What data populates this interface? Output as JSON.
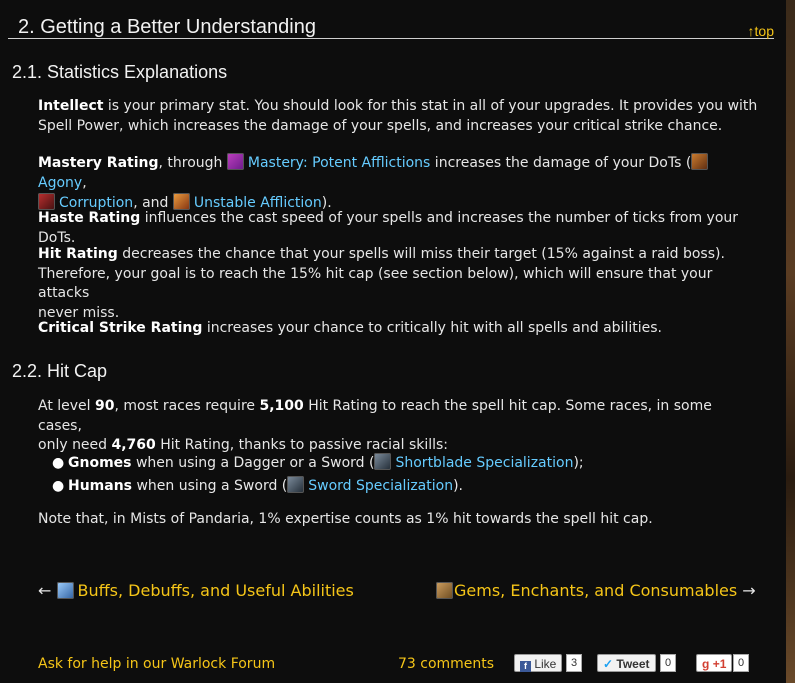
{
  "section": {
    "title": "2. Getting a Better Understanding",
    "top_link": "↑top"
  },
  "s21": {
    "title": "2.1. Statistics Explanations",
    "p1_bold": "Intellect",
    "p1_l1": " is your primary stat. You should look for this stat in all of your upgrades. It provides you with",
    "p1_l2": "Spell Power, which increases the damage of your spells, and increases your critical strike chance.",
    "p2_bold": "Mastery Rating",
    "p2_a": ", through ",
    "p2_link1": "Mastery: Potent Afflictions",
    "p2_b": " increases the damage of your DoTs (",
    "p2_link2": "Agony",
    "p2_c": ",",
    "p2_link3": "Corruption",
    "p2_d": ", and ",
    "p2_link4": "Unstable Affliction",
    "p2_e": ").",
    "p3_bold": "Haste Rating",
    "p3_text": " influences the cast speed of your spells and increases the number of ticks from your DoTs.",
    "p4_bold": "Hit Rating",
    "p4_l1": " decreases the chance that your spells will miss their target (15% against a raid boss).",
    "p4_l2": "Therefore, your goal is to reach the 15% hit cap (see section below), which will ensure that your attacks",
    "p4_l3": "never miss.",
    "p5_bold": "Critical Strike Rating",
    "p5_text": " increases your chance to critically hit with all spells and abilities."
  },
  "s22": {
    "title": "2.2. Hit Cap",
    "p1_a": "At level ",
    "p1_level": "90",
    "p1_b": ", most races require ",
    "p1_val1": "5,100",
    "p1_c": " Hit Rating to reach the spell hit cap. Some races, in some cases,",
    "p1_d": "only need ",
    "p1_val2": "4,760",
    "p1_e": " Hit Rating, thanks to passive racial skills:",
    "items": [
      {
        "bold": "Gnomes",
        "text": " when using a Dagger or a Sword (",
        "link": "Shortblade Specialization",
        "end": ");"
      },
      {
        "bold": "Humans",
        "text": " when using a Sword (",
        "link": "Sword Specialization",
        "end": ")."
      }
    ],
    "note": "Note that, in Mists of Pandaria, 1% expertise counts as 1% hit towards the spell hit cap."
  },
  "nav": {
    "prev_arrow": "←",
    "prev": "Buffs, Debuffs, and Useful Abilities",
    "next": "Gems, Enchants, and Consumables",
    "next_arrow": "→"
  },
  "footer": {
    "help": "Ask for help in our Warlock Forum",
    "comments": "73 comments",
    "like": "Like",
    "like_count": "3",
    "tweet": "Tweet",
    "tweet_count": "0",
    "gplus": "+1",
    "gplus_count": "0"
  },
  "icons": [
    "mastery-icon",
    "agony-icon",
    "corruption-icon",
    "unstable-affliction-icon",
    "shortblade-icon",
    "sword-icon",
    "buffs-icon",
    "gems-icon",
    "facebook-icon",
    "twitter-icon",
    "google-plus-icon"
  ],
  "colors": {
    "background": "#0d0d0d",
    "link": "#66ccff",
    "accent": "#f5c518",
    "text": "#e6e6e6"
  }
}
